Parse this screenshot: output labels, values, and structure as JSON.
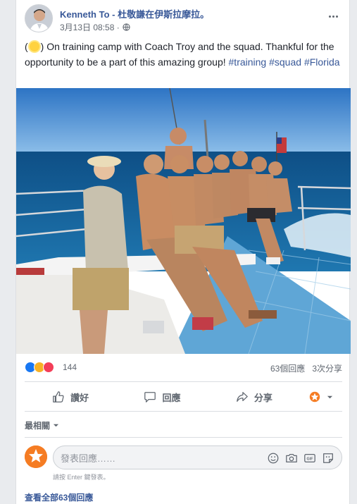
{
  "post": {
    "author": "Kenneth To - 杜敬謙在伊斯拉摩拉。",
    "timestamp": "3月13日 08:58 ·",
    "audience_icon": "globe-icon",
    "text_before_emoji": "(",
    "emoji": "sun-emoji",
    "text_main": ") On training camp with Coach Troy and the squad. Thankful for the opportunity to be a part of this amazing group! ",
    "hashtags": [
      "#training",
      "#squad",
      "#Florida"
    ]
  },
  "reactions": {
    "icons": [
      "like-reaction-icon",
      "sad-reaction-icon",
      "love-reaction-icon"
    ],
    "colors": {
      "like": "#1877f2",
      "sad": "#f7b125",
      "love": "#f33e58"
    },
    "count": "144",
    "comments": "63個回應",
    "shares": "3次分享"
  },
  "actions": {
    "like": "讚好",
    "comment": "回應",
    "share": "分享"
  },
  "sort": {
    "label": "最相關"
  },
  "composer": {
    "placeholder": "發表回應……",
    "hint": "請按 Enter 鍵發表。",
    "icons": [
      "emoji-icon",
      "camera-icon",
      "gif-icon",
      "sticker-icon"
    ]
  },
  "view_all": "查看全部63個回應",
  "colors": {
    "link": "#385898",
    "muted": "#606770",
    "divider": "#dadde1"
  }
}
